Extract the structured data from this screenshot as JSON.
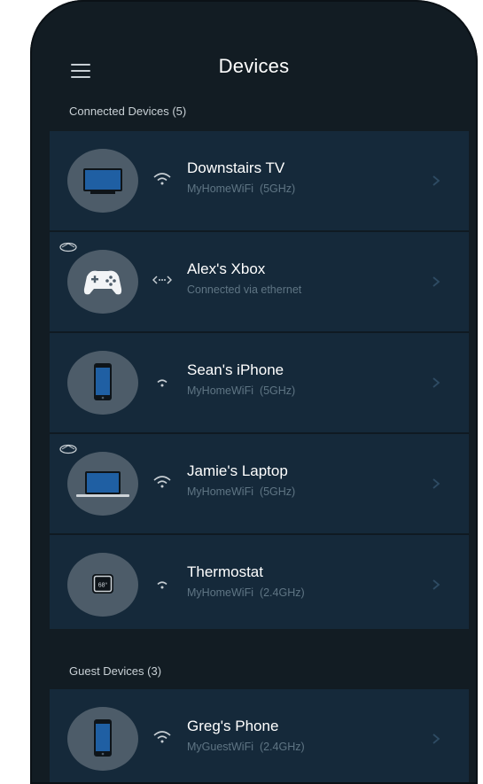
{
  "header": {
    "title": "Devices"
  },
  "sections": {
    "connected": {
      "label": "Connected Devices (5)"
    },
    "guest": {
      "label": "Guest Devices (3)"
    }
  },
  "devices": [
    {
      "name": "Downstairs TV",
      "sub": "MyHomeWiFi  (5GHz)",
      "icon": "tv-icon",
      "connection": "wifi-icon"
    },
    {
      "name": "Alex's Xbox",
      "sub": "Connected via ethernet",
      "icon": "gamepad-icon",
      "connection": "ethernet-icon"
    },
    {
      "name": "Sean's iPhone",
      "sub": "MyHomeWiFi  (5GHz)",
      "icon": "phone-icon",
      "connection": "wifi-icon"
    },
    {
      "name": "Jamie's Laptop",
      "sub": "MyHomeWiFi  (5GHz)",
      "icon": "laptop-icon",
      "connection": "wifi-icon"
    },
    {
      "name": "Thermostat",
      "sub": "MyHomeWiFi  (2.4GHz)",
      "icon": "thermostat-icon",
      "connection": "wifi-icon",
      "thermostat_reading": "68°"
    }
  ],
  "guest_devices": [
    {
      "name": "Greg's Phone",
      "sub": "MyGuestWiFi  (2.4GHz)",
      "icon": "phone-icon",
      "connection": "wifi-icon"
    }
  ],
  "colors": {
    "background": "#121c23",
    "card": "#15293a",
    "avatar": "#4d5c69",
    "secondary_text": "#5f7584",
    "screen_blue": "#1f5fa3"
  }
}
